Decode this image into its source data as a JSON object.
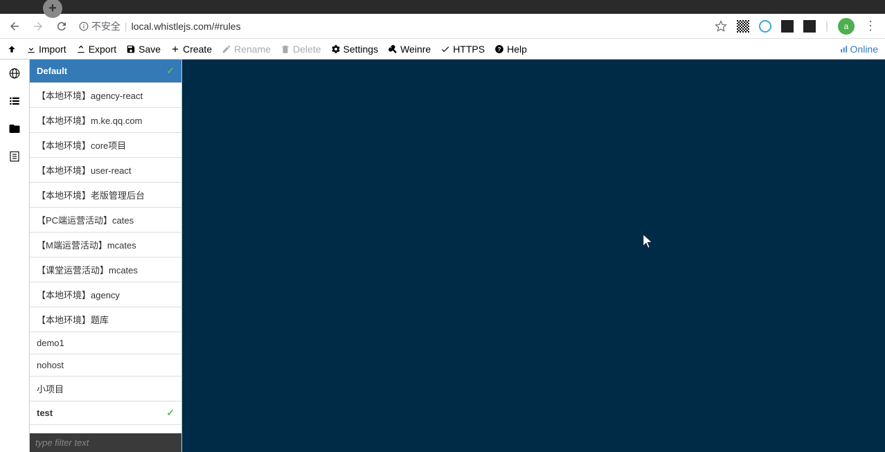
{
  "browser": {
    "unsafe_label": "不安全",
    "url": "local.whistlejs.com/#rules",
    "avatar_letter": "a"
  },
  "toolbar": {
    "import": "Import",
    "export": "Export",
    "save": "Save",
    "create": "Create",
    "rename": "Rename",
    "delete": "Delete",
    "settings": "Settings",
    "weinre": "Weinre",
    "https": "HTTPS",
    "help": "Help",
    "online": "Online"
  },
  "rules": {
    "items": [
      {
        "label": "Default",
        "selected": true,
        "checked": true
      },
      {
        "label": "【本地环境】agency-react"
      },
      {
        "label": "【本地环境】m.ke.qq.com"
      },
      {
        "label": "【本地环境】core项目"
      },
      {
        "label": "【本地环境】user-react"
      },
      {
        "label": "【本地环境】老版管理后台"
      },
      {
        "label": "【PC端运营活动】cates"
      },
      {
        "label": "【M端运营活动】mcates"
      },
      {
        "label": "【课堂运营活动】mcates"
      },
      {
        "label": "【本地环境】agency"
      },
      {
        "label": "【本地环境】题库"
      },
      {
        "label": "demo1"
      },
      {
        "label": "nohost"
      },
      {
        "label": "小项目"
      },
      {
        "label": "test",
        "active": true,
        "checked": true
      }
    ],
    "filter_placeholder": "type filter text"
  }
}
